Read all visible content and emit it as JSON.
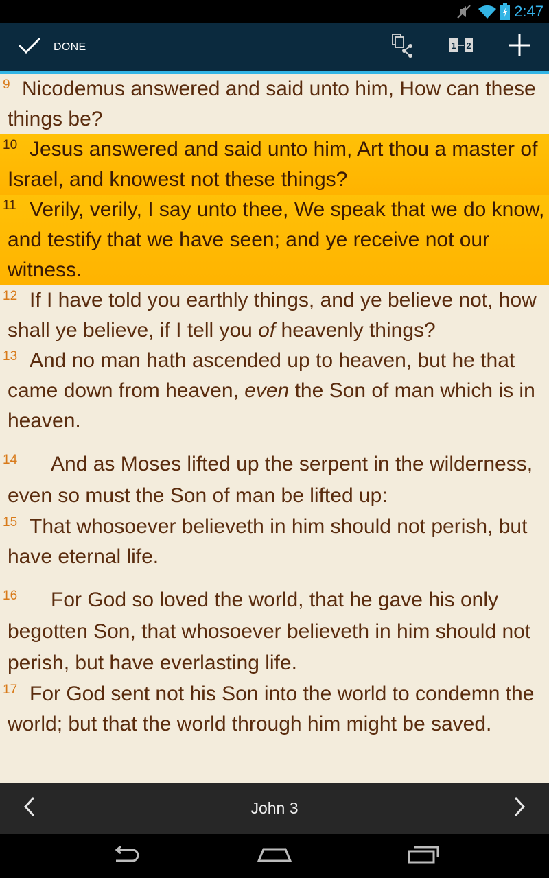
{
  "status_bar": {
    "time": "2:47",
    "icons": [
      "mute-icon",
      "wifi-icon",
      "battery-icon"
    ]
  },
  "action_bar": {
    "done_label": "DONE",
    "buttons": [
      "copy-share-icon",
      "compare-icon",
      "add-icon"
    ],
    "compare_label": "1↔2"
  },
  "verses": [
    {
      "num": "9",
      "text": "Nicodemus answered and said unto him, How can these things be?",
      "highlighted": false
    },
    {
      "num": "10",
      "text": "Jesus answered and said unto him, Art thou a master of Israel, and knowest not these things?",
      "highlighted": true
    },
    {
      "num": "11",
      "text": "Verily, verily, I say unto thee, We speak that we do know, and testify that we have seen; and ye receive not our witness.",
      "highlighted": true
    },
    {
      "num": "12",
      "text_before": "If I have told you earthly things, and ye believe not, how shall ye believe, if I tell you ",
      "text_italic": "of",
      "text_after": " heavenly things?",
      "highlighted": false
    },
    {
      "num": "13",
      "text_before": "And no man hath ascended up to heaven, but he that came down from heaven, ",
      "text_italic": "even",
      "text_after": " the Son of man which is in heaven.",
      "highlighted": false
    },
    {
      "num": "14",
      "text": "And as Moses lifted up the serpent in the wilderness, even so must the Son of man be lifted up:",
      "highlighted": false
    },
    {
      "num": "15",
      "text": "That whosoever believeth in him should not perish, but have eternal life.",
      "highlighted": false
    },
    {
      "num": "16",
      "text": "For God so loved the world, that he gave his only begotten Son, that whosoever believeth in him should not perish, but have everlasting life.",
      "highlighted": false
    },
    {
      "num": "17",
      "text": "For God sent not his Son into the world to condemn the world; but that the world through him might be saved.",
      "highlighted": false
    }
  ],
  "bottom_nav": {
    "title": "John 3",
    "prev_icon": "chevron-left-icon",
    "next_icon": "chevron-right-icon"
  },
  "system_nav": [
    "back-icon",
    "home-icon",
    "recents-icon"
  ],
  "colors": {
    "action_bar": "#0b2a3e",
    "accent": "#33b5e5",
    "highlight": "#ffc107",
    "page_background": "#f3ecdc",
    "verse_text": "#5a2c0e",
    "verse_number": "#d87a1a"
  }
}
